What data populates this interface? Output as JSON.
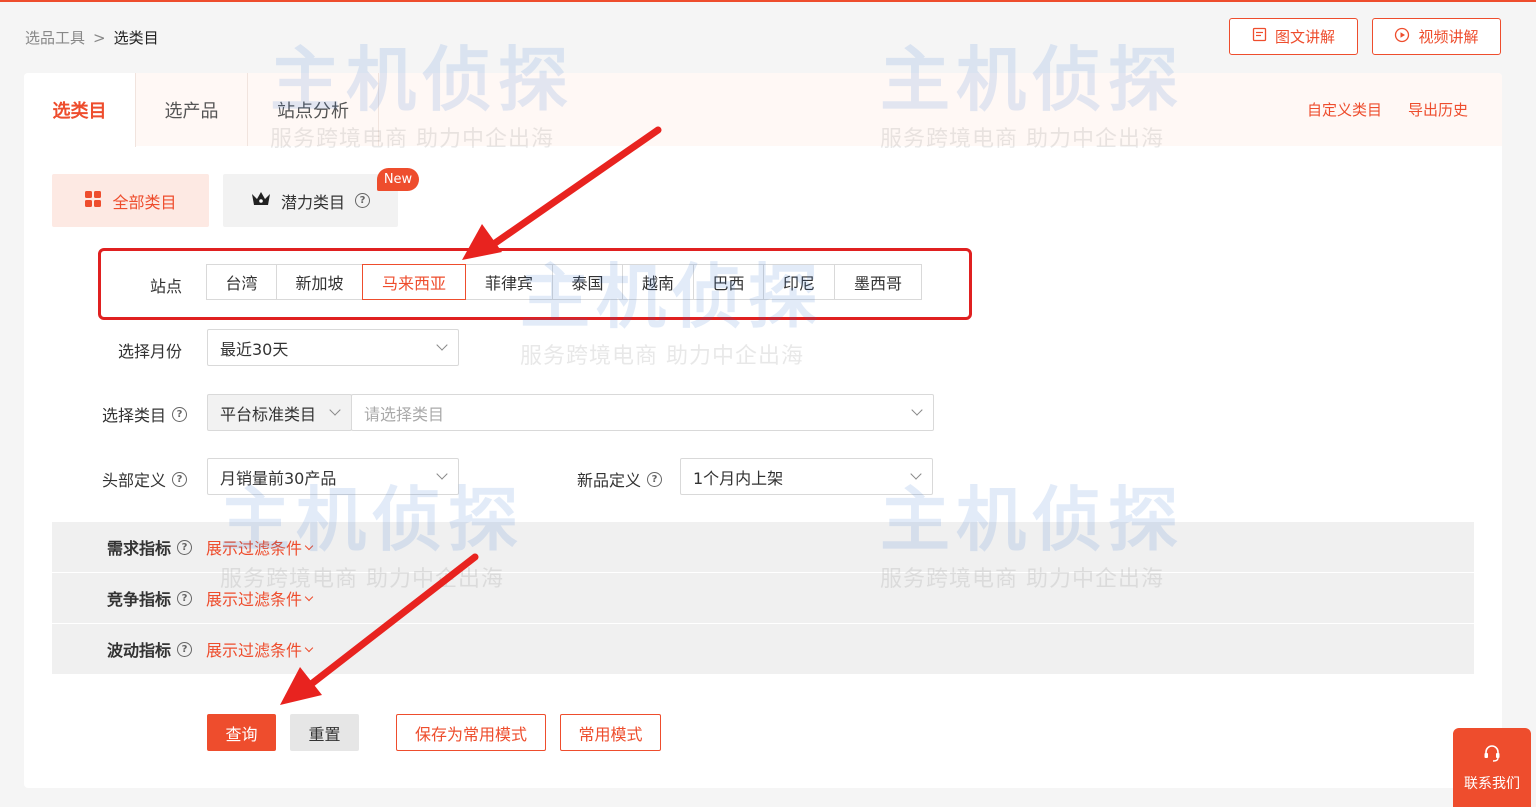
{
  "breadcrumb": {
    "parent": "选品工具",
    "separator": ">",
    "current": "选类目"
  },
  "top_buttons": {
    "doc": "图文讲解",
    "video": "视频讲解"
  },
  "tabs": [
    "选类目",
    "选产品",
    "站点分析"
  ],
  "tab_links": {
    "custom": "自定义类目",
    "export": "导出历史"
  },
  "category_buttons": {
    "all": "全部类目",
    "potential": "潜力类目",
    "new_badge": "New"
  },
  "site_field": {
    "label": "站点",
    "options": [
      "台湾",
      "新加坡",
      "马来西亚",
      "菲律宾",
      "泰国",
      "越南",
      "巴西",
      "印尼",
      "墨西哥"
    ],
    "selected": "马来西亚"
  },
  "month_field": {
    "label": "选择月份",
    "value": "最近30天"
  },
  "category_field": {
    "label": "选择类目",
    "type_value": "平台标准类目",
    "placeholder": "请选择类目"
  },
  "head_field": {
    "label": "头部定义",
    "value": "月销量前30产品"
  },
  "newprod_field": {
    "label": "新品定义",
    "value": "1个月内上架"
  },
  "filters": [
    {
      "label": "需求指标",
      "link": "展示过滤条件"
    },
    {
      "label": "竞争指标",
      "link": "展示过滤条件"
    },
    {
      "label": "波动指标",
      "link": "展示过滤条件"
    }
  ],
  "actions": {
    "query": "查询",
    "reset": "重置",
    "save_mode": "保存为常用模式",
    "common_mode": "常用模式"
  },
  "contact": "联系我们",
  "watermark": {
    "title": "主机侦探",
    "slogan": "服务跨境电商 助力中企出海"
  },
  "colors": {
    "accent": "#ee4d2d",
    "highlight_box": "#e02020"
  }
}
